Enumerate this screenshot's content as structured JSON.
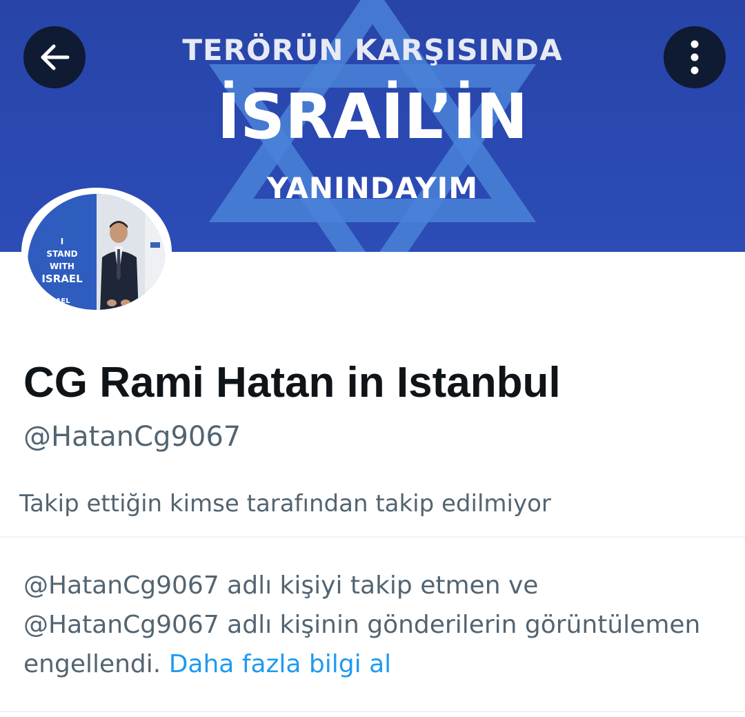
{
  "header": {
    "back_icon": "arrow-left-icon",
    "more_icon": "more-vertical-icon",
    "button_bg": "#0f1a33"
  },
  "banner": {
    "line1": "TERÖRÜN KARŞISINDA",
    "line2": "İSRAİL’İN",
    "line3": "YANINDAYIM",
    "bg_color": "#2a49b2",
    "star_color": "#4a83d8"
  },
  "avatar": {
    "line1": "I",
    "line2": "STAND",
    "line3": "WITH",
    "line4": "ISRAEL",
    "footer": "ISRAEL"
  },
  "profile": {
    "display_name": "CG Rami Hatan in Istanbul",
    "handle": "@HatanCg9067",
    "followed_by_text": "Takip ettiğin kimse tarafından takip edilmiyor"
  },
  "blocked_notice": {
    "message": "@HatanCg9067 adlı kişiyi takip etmen ve @HatanCg9067 adlı kişinin gönderilerin görüntülemen engellendi.",
    "link_label": "Daha fazla bilgi al",
    "link_color": "#1d9bf0"
  }
}
